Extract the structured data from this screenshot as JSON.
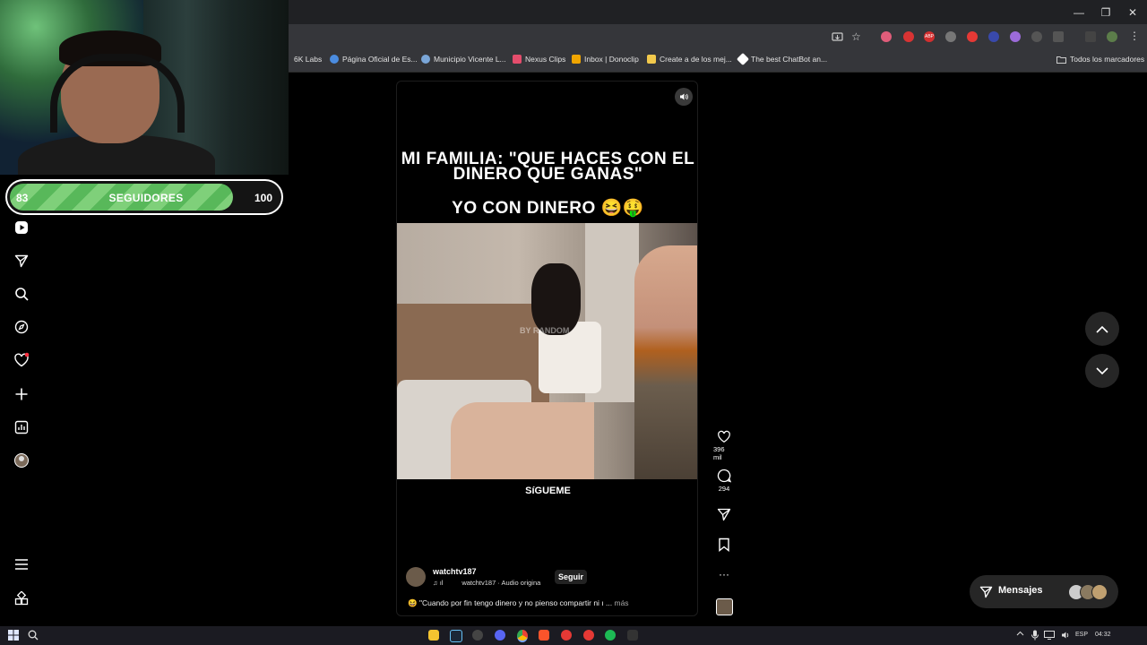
{
  "browser": {
    "window_controls": {
      "minimize": "—",
      "maximize": "❐",
      "close": "✕"
    },
    "bookmarks": [
      {
        "label": "6K Labs",
        "color": "#e0e0e0"
      },
      {
        "label": "Página Oficial de Es...",
        "color": "#4b8ce0"
      },
      {
        "label": "Municipio Vicente L...",
        "color": "#7aa6d8"
      },
      {
        "label": "Nexus Clips",
        "color": "#e44d6c"
      },
      {
        "label": "Inbox | Donoclip",
        "color": "#f0a500"
      },
      {
        "label": "Create a de los mej...",
        "color": "#f2c94c"
      },
      {
        "label": "The best ChatBot an...",
        "color": "#ffffff"
      }
    ],
    "all_bookmarks_label": "Todos los marcadores"
  },
  "stream_overlay": {
    "followers_current": "83",
    "followers_label": "SEGUIDORES",
    "followers_goal": "100",
    "progress": 0.83
  },
  "sidebar_icons": [
    "reels-icon",
    "send-icon",
    "search-icon",
    "explore-icon",
    "heart-icon",
    "create-icon",
    "dashboard-icon",
    "profile-icon",
    "menu-icon",
    "more-apps-icon"
  ],
  "reel": {
    "title_line1": "MI FAMILIA: \"QUE HACES CON EL",
    "title_line2": "DINERO QUE GANAS\"",
    "title_line3": "YO CON DINERO 😆🤑",
    "watermark": "BY RANDOM",
    "mid_caption": "SíGUEME",
    "username": "watchtv187",
    "audio_prefix": "♫ ıl",
    "audio_label": "watchtv187 · Audio origina",
    "follow_label": "Seguir",
    "description": "😆 \"Cuando por fin tengo dinero y no pienso compartir ni ı ...",
    "more_label": "más"
  },
  "actions": {
    "likes": "396 mil",
    "comments": "294",
    "more": "···"
  },
  "messages": {
    "label": "Mensajes"
  },
  "taskbar": {
    "lang": "ESP",
    "time": "04:32"
  },
  "colors": {
    "progress_green": "#5cbc5e",
    "chrome_dark": "#202124",
    "toolbar": "#35363a"
  }
}
